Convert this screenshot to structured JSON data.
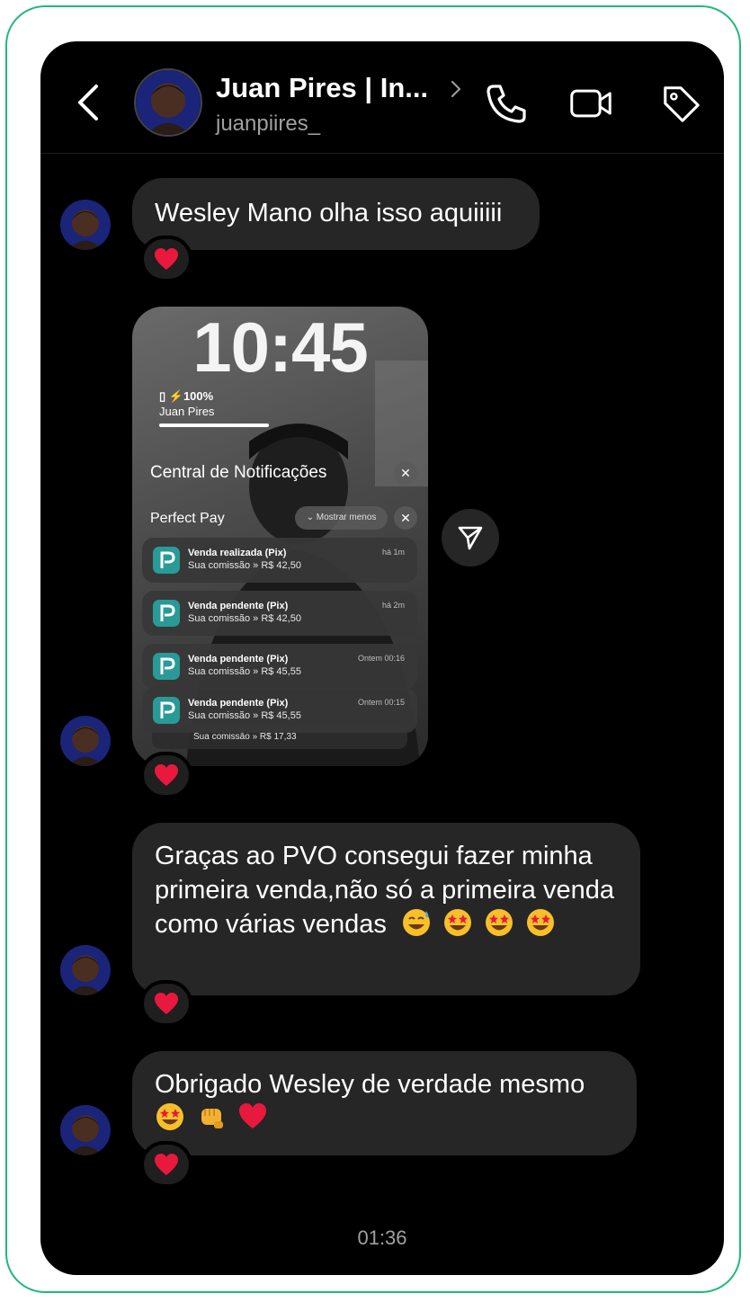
{
  "header": {
    "contact_name": "Juan Pires | In...",
    "username": "juanpiires_"
  },
  "messages": [
    {
      "text": "Wesley Mano olha isso aquiiiii",
      "reaction": "heart"
    },
    {
      "type": "image",
      "reaction": "heart"
    },
    {
      "text": "Graças ao PVO consegui fazer minha primeira venda,não só a primeira venda como várias vendas",
      "emojis": [
        "sweat-smile",
        "star-struck",
        "star-struck",
        "star-struck"
      ],
      "reaction": "heart"
    },
    {
      "text": "Obrigado Wesley de verdade mesmo",
      "emojis": [
        "star-struck",
        "fist",
        "red-heart"
      ],
      "reaction": "heart"
    }
  ],
  "lockscreen": {
    "time": "10:45",
    "battery": "100%",
    "owner": "Juan Pires",
    "notification_center_label": "Central de Notificações",
    "app_group": "Perfect Pay",
    "show_less": "Mostrar menos",
    "notifications": [
      {
        "title": "Venda realizada (Pix)",
        "body": "Sua comissão » R$ 42,50",
        "time": "há 1m"
      },
      {
        "title": "Venda pendente (Pix)",
        "body": "Sua comissão » R$ 42,50",
        "time": "há 2m"
      },
      {
        "title": "Venda pendente (Pix)",
        "body": "Sua comissão » R$ 45,55",
        "time": "Ontem 00:16"
      },
      {
        "title": "Venda pendente (Pix)",
        "body": "Sua comissão » R$ 45,55",
        "time": "Ontem 00:15"
      },
      {
        "body": "Sua comissão » R$ 17,33"
      }
    ]
  },
  "footer": {
    "timestamp": "01:36"
  },
  "colors": {
    "frame_border": "#1fb97a",
    "bubble": "#262626",
    "heart": "#e8193c",
    "app_icon": "#2a9a98"
  }
}
